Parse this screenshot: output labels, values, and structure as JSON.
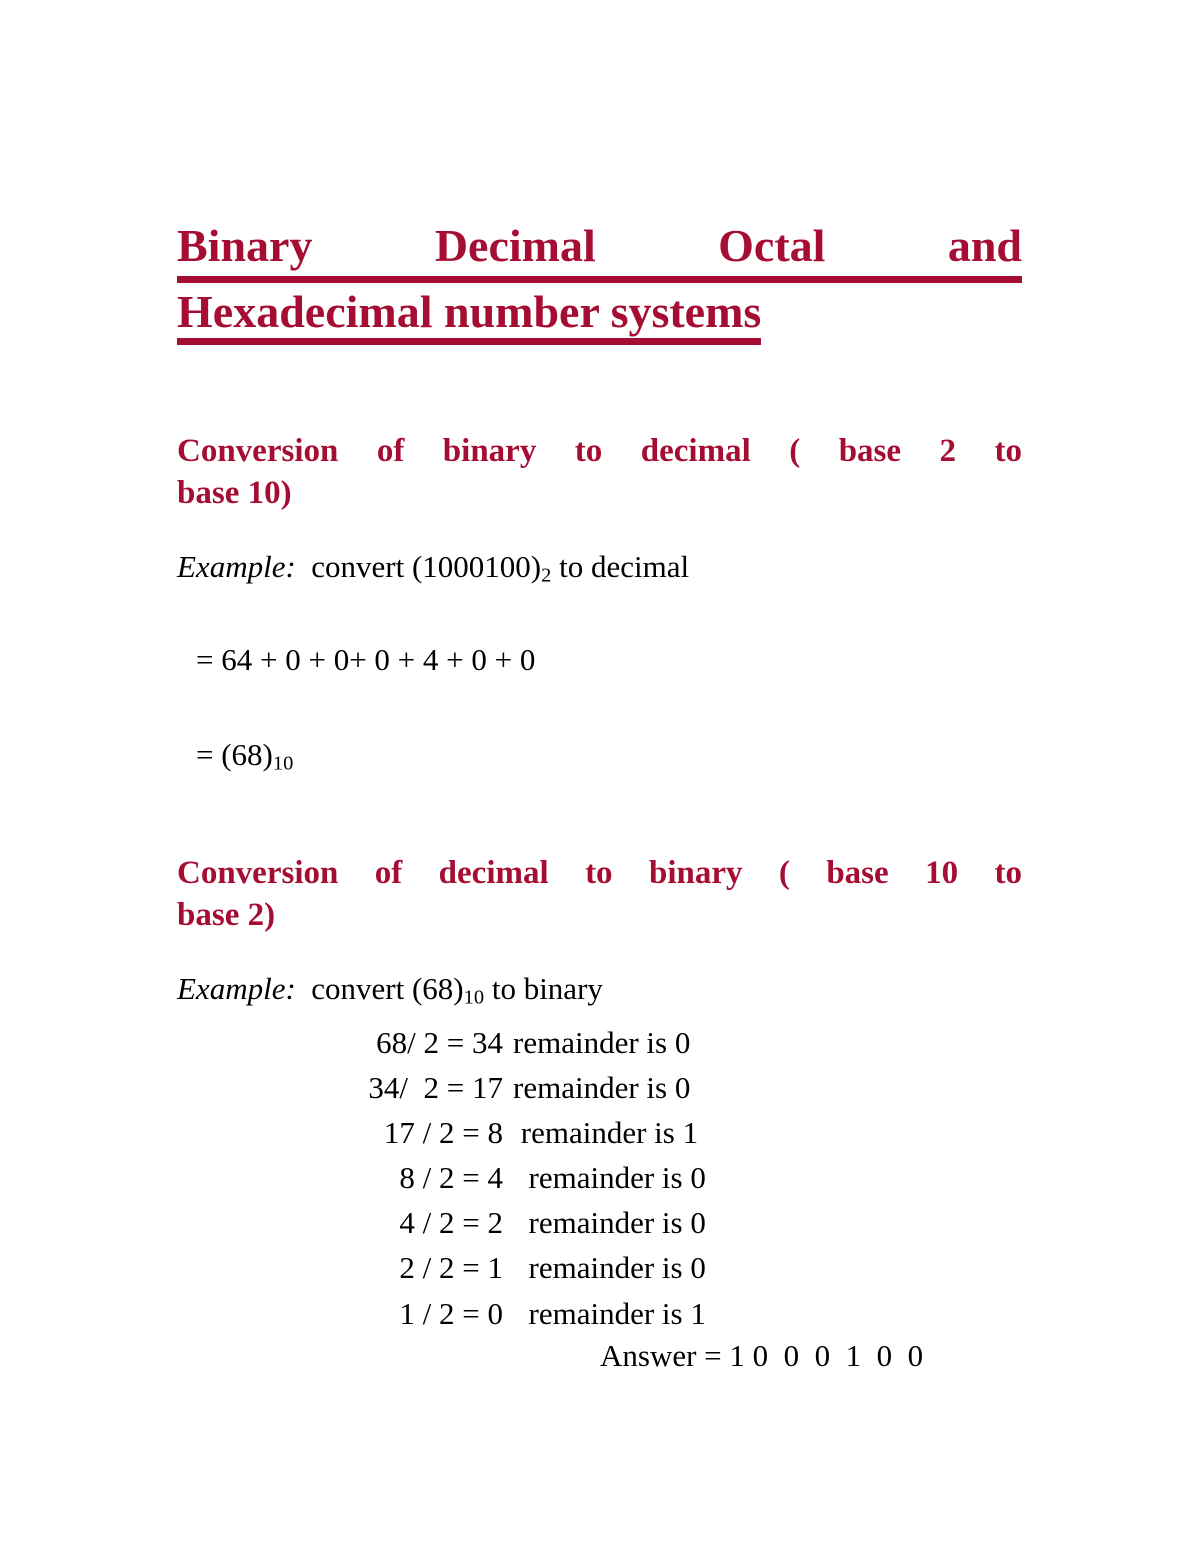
{
  "document": {
    "page_background": "#ffffff",
    "accent_color": "#A50D33",
    "text_color": "#000000"
  },
  "title": {
    "line1": "Binary Decimal Octal and",
    "line2": "Hexadecimal number systems"
  },
  "sections": [
    {
      "heading_line1": "Conversion of binary to decimal ( base 2 to",
      "heading_line2": "base 10)",
      "example_label": "Example:",
      "example_text_before": "  convert (1000100)",
      "example_subscript": "2",
      "example_text_after": " to decimal",
      "equation_sum": "= 64 + 0 + 0+ 0 + 4 + 0 + 0",
      "equation_result_prefix": "= (68)",
      "equation_result_subscript": "10"
    },
    {
      "heading_line1": "Conversion of decimal to binary ( base 10 to",
      "heading_line2": "base 2)",
      "example_label": "Example:",
      "example_text_before": "  convert (68)",
      "example_subscript": "10",
      "example_text_after": " to binary",
      "steps": [
        {
          "lhs": "68/ 2 = 34",
          "rhs": "remainder is 0"
        },
        {
          "lhs": "34/  2 = 17",
          "rhs": "remainder is 0"
        },
        {
          "lhs": "17 / 2 = 8",
          "rhs": " remainder is 1"
        },
        {
          "lhs": "8 / 2 = 4",
          "rhs": "  remainder is 0"
        },
        {
          "lhs": "4 / 2 = 2",
          "rhs": "  remainder is 0"
        },
        {
          "lhs": "2 / 2 = 1",
          "rhs": "  remainder is 0"
        },
        {
          "lhs": "1 / 2 = 0",
          "rhs": "  remainder is 1"
        }
      ],
      "answer": "Answer = 1 0  0  0  1  0  0"
    }
  ]
}
